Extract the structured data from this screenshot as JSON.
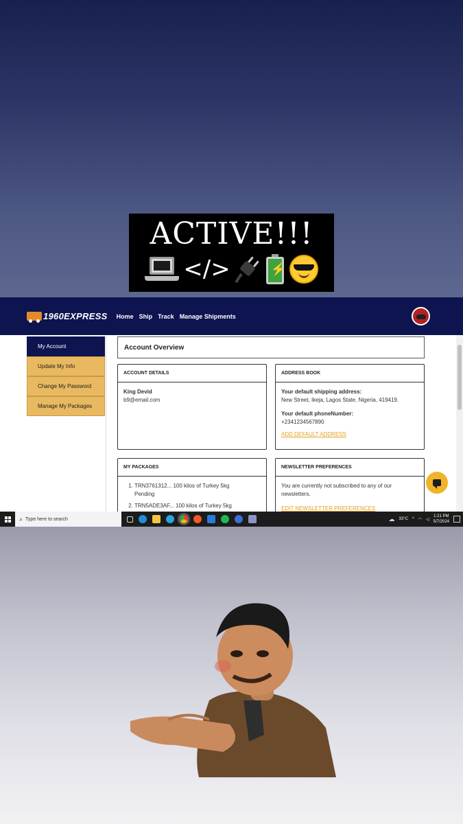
{
  "banner": {
    "title": "ACTIVE!!!",
    "code_tag": "</>"
  },
  "app": {
    "logo": "1960EXPRESS",
    "nav": [
      "Home",
      "Ship",
      "Track",
      "Manage Shipments"
    ],
    "sidebar": [
      "My Account",
      "Update My Info",
      "Change My Password",
      "Manage My Packages"
    ],
    "overview_title": "Account Overview",
    "account_details": {
      "heading": "ACCOUNT DETAILS",
      "name": "King Devid",
      "email": "b9@email.com"
    },
    "address_book": {
      "heading": "ADDRESS BOOK",
      "shipping_label": "Your default shipping address:",
      "shipping_value": "New Street, Ikeja, Lagos State, Nigeria, 419419.",
      "phone_label": "Your default phoneNumber:",
      "phone_value": "+2341234567890",
      "add_link": "ADD DEFAULT ADDRESS"
    },
    "packages": {
      "heading": "MY PACKAGES",
      "items": [
        {
          "desc": "TRN3761312... 100 kilos of Turkey 5kg",
          "status": "Pending"
        },
        {
          "desc": "TRN5ADE3AF... 100 kilos of Turkey 5kg",
          "status": ""
        }
      ]
    },
    "newsletter": {
      "heading": "NEWSLETTER PREFERENCES",
      "text": "You are currently not subscribed to any of our newsletters.",
      "edit_link": "EDIT NEWSLETTER PREFERENCES"
    }
  },
  "taskbar": {
    "search_placeholder": "Type here to search",
    "weather": "33°C",
    "time": "1:21 PM",
    "date": "5/7/2024"
  },
  "colors": {
    "navbar": "#0e1450",
    "sidebar_inactive": "#e8b960",
    "accent": "#e0a020",
    "chat_button": "#f0b429"
  },
  "icons": [
    "windows-icon",
    "search-icon",
    "task-view-icon",
    "edge-icon",
    "file-explorer-icon",
    "telegram-icon",
    "chrome-icon",
    "postman-icon",
    "vscode-icon",
    "spotify-icon",
    "app-icon",
    "notes-icon",
    "weather-icon",
    "wifi-icon",
    "volume-icon",
    "chat-icon"
  ]
}
